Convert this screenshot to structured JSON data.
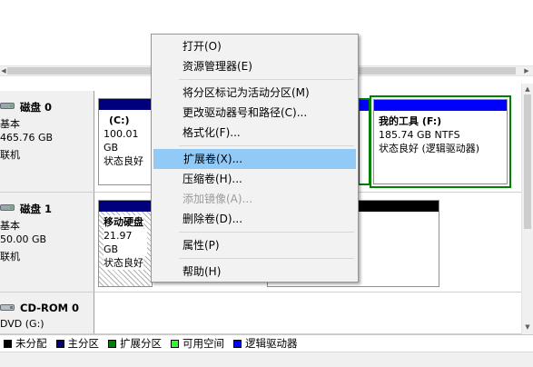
{
  "scrollbars": {
    "left_arrow": "◀",
    "right_arrow": "▶",
    "up_arrow": "▲",
    "down_arrow": "▼"
  },
  "disks": [
    {
      "name": "磁盘 0",
      "type": "基本",
      "size": "465.76 GB",
      "status": "联机"
    },
    {
      "name": "磁盘 1",
      "type": "基本",
      "size": "50.00 GB",
      "status": "联机"
    },
    {
      "name": "CD-ROM 0",
      "type": "DVD (G:)"
    }
  ],
  "volumes": {
    "c": {
      "name": "(C:)",
      "size": "100.01 GB",
      "status": "状态良好"
    },
    "f": {
      "name": "我的工具 (F:)",
      "size": "185.74 GB NTFS",
      "status": "状态良好 (逻辑驱动器)"
    },
    "mobile": {
      "name": "移动硬盘",
      "size": "21.97 GB",
      "status": "状态良好"
    }
  },
  "legend": [
    {
      "label": "未分配",
      "color": "#000000"
    },
    {
      "label": "主分区",
      "color": "#00007f"
    },
    {
      "label": "扩展分区",
      "color": "#008000"
    },
    {
      "label": "可用空间",
      "color": "#2aff2a"
    },
    {
      "label": "逻辑驱动器",
      "color": "#0000ff"
    }
  ],
  "colors": {
    "primary_partition": "#00007f",
    "extended_partition": "#008000",
    "logical_drive": "#0000ff",
    "unallocated": "#000000",
    "menu_highlight": "#91c9f7"
  },
  "context_menu": {
    "items": [
      {
        "label": "打开(O)",
        "enabled": true
      },
      {
        "label": "资源管理器(E)",
        "enabled": true
      },
      {
        "label": "将分区标记为活动分区(M)",
        "enabled": true
      },
      {
        "label": "更改驱动器号和路径(C)...",
        "enabled": true
      },
      {
        "label": "格式化(F)...",
        "enabled": true
      },
      {
        "label": "扩展卷(X)...",
        "enabled": true,
        "highlighted": true
      },
      {
        "label": "压缩卷(H)...",
        "enabled": true
      },
      {
        "label": "添加镜像(A)...",
        "enabled": false
      },
      {
        "label": "删除卷(D)...",
        "enabled": true
      },
      {
        "label": "属性(P)",
        "enabled": true
      },
      {
        "label": "帮助(H)",
        "enabled": true
      }
    ]
  }
}
